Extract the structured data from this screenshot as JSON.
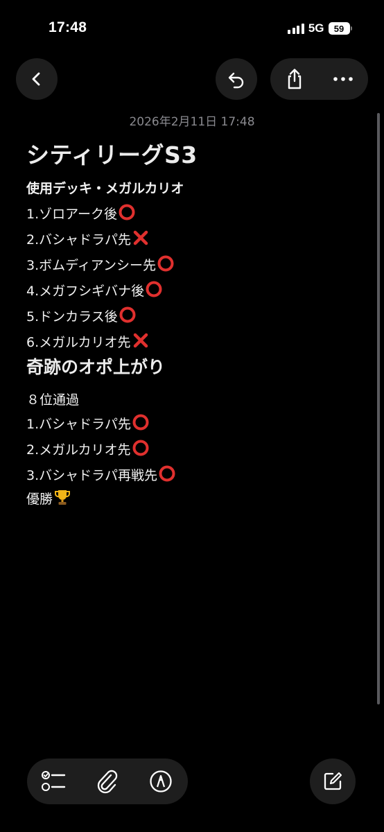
{
  "status_bar": {
    "time": "17:48",
    "network": "5G",
    "battery": "59"
  },
  "toolbar": {
    "back_icon": "chevron-left-icon",
    "undo_icon": "undo-icon",
    "share_icon": "share-icon",
    "more_icon": "ellipsis-icon"
  },
  "note": {
    "date": "2026年2月11日 17:48",
    "title": "シティリーグS3",
    "lines": [
      {
        "text": "使用デッキ・メガルカリオ",
        "mark": "",
        "style": "bold"
      },
      {
        "text": "1.ゾロアーク後",
        "mark": "circle",
        "style": ""
      },
      {
        "text": "2.バシャドラパ先",
        "mark": "cross",
        "style": ""
      },
      {
        "text": "3.ボムディアンシー先",
        "mark": "circle",
        "style": ""
      },
      {
        "text": "4.メガフシギバナ後",
        "mark": "circle",
        "style": ""
      },
      {
        "text": "5.ドンカラス後",
        "mark": "circle",
        "style": ""
      },
      {
        "text": "6.メガルカリオ先",
        "mark": "cross",
        "style": ""
      },
      {
        "text": "奇跡のオポ上がり",
        "mark": "",
        "style": "heading"
      },
      {
        "text": "８位通過",
        "mark": "",
        "style": ""
      },
      {
        "text": "1.バシャドラパ先",
        "mark": "circle",
        "style": ""
      },
      {
        "text": "2.メガルカリオ先",
        "mark": "circle",
        "style": ""
      },
      {
        "text": "3.バシャドラパ再戦先",
        "mark": "circle",
        "style": ""
      },
      {
        "text": "優勝",
        "mark": "trophy",
        "style": ""
      }
    ]
  },
  "bottom_toolbar": {
    "checklist_icon": "checklist-icon",
    "attachment_icon": "paperclip-icon",
    "markup_icon": "markup-pen-icon",
    "compose_icon": "compose-icon"
  },
  "colors": {
    "background": "#000000",
    "button_bg": "#1e1e1e",
    "result_win": "#e0302e",
    "result_loss": "#e0302e",
    "secondary_text": "#8a8a8f"
  }
}
